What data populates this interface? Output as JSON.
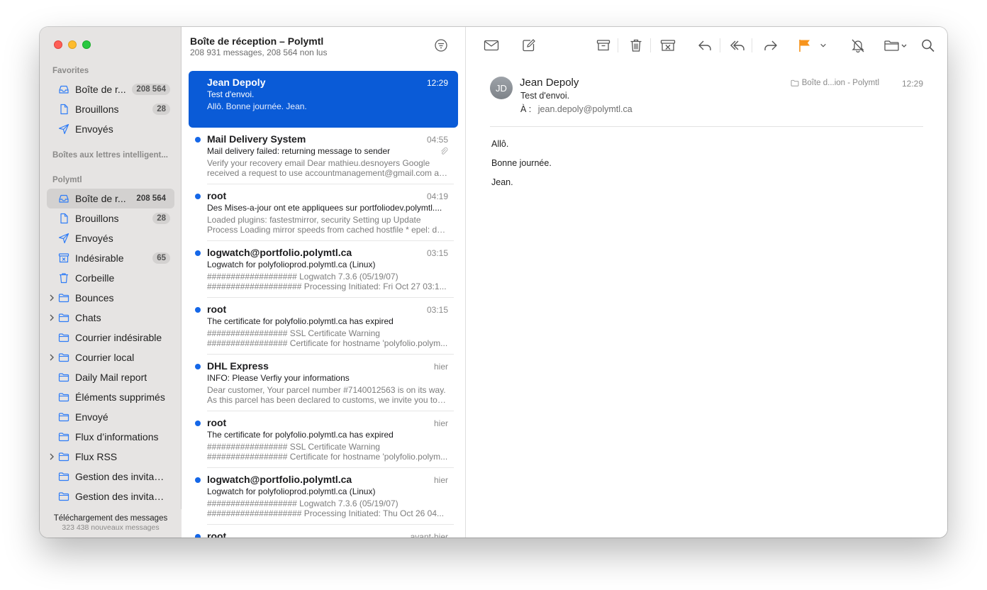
{
  "sidebar": {
    "favorites_title": "Favorites",
    "favorites": [
      {
        "label": "Boîte de r...",
        "badge": "208 564",
        "icon": "inbox-icon"
      },
      {
        "label": "Brouillons",
        "badge": "28",
        "icon": "document-icon"
      },
      {
        "label": "Envoyés",
        "badge": "",
        "icon": "paperplane-icon"
      }
    ],
    "smart_title": "Boîtes aux lettres intelligent...",
    "account_title": "Polymtl",
    "account": [
      {
        "label": "Boîte de r...",
        "badge": "208 564",
        "icon": "inbox-icon",
        "active": true
      },
      {
        "label": "Brouillons",
        "badge": "28",
        "icon": "document-icon"
      },
      {
        "label": "Envoyés",
        "badge": "",
        "icon": "paperplane-icon"
      },
      {
        "label": "Indésirable",
        "badge": "65",
        "icon": "junk-icon"
      },
      {
        "label": "Corbeille",
        "badge": "",
        "icon": "trash-icon"
      },
      {
        "label": "Bounces",
        "badge": "",
        "icon": "folder-icon",
        "expandable": true
      },
      {
        "label": "Chats",
        "badge": "",
        "icon": "folder-icon",
        "expandable": true
      },
      {
        "label": "Courrier indésirable",
        "badge": "",
        "icon": "folder-icon"
      },
      {
        "label": "Courrier local",
        "badge": "",
        "icon": "folder-icon",
        "expandable": true
      },
      {
        "label": "Daily Mail report",
        "badge": "",
        "icon": "folder-icon"
      },
      {
        "label": "Éléments supprimés",
        "badge": "",
        "icon": "folder-icon"
      },
      {
        "label": "Envoyé",
        "badge": "",
        "icon": "folder-icon"
      },
      {
        "label": "Flux d’informations",
        "badge": "",
        "icon": "folder-icon"
      },
      {
        "label": "Flux RSS",
        "badge": "",
        "icon": "folder-icon",
        "expandable": true
      },
      {
        "label": "Gestion des invitati...",
        "badge": "",
        "icon": "folder-icon"
      },
      {
        "label": "Gestion des invitati...",
        "badge": "",
        "icon": "folder-icon"
      }
    ],
    "footer_status": "Téléchargement des messages",
    "footer_count": "323 438 nouveaux messages"
  },
  "mailbox": {
    "title": "Boîte de réception – Polymtl",
    "subtitle": "208 931 messages, 208 564 non lus"
  },
  "messages": [
    {
      "from": "Jean Depoly",
      "time": "12:29",
      "subject": "Test d'envoi.",
      "preview": [
        "Allô. Bonne journée. Jean.",
        ""
      ],
      "unread": false,
      "selected": true
    },
    {
      "from": "Mail Delivery System",
      "time": "04:55",
      "subject": "Mail delivery failed: returning message to sender",
      "preview": [
        "Verify your recovery email Dear mathieu.desnoyers Google",
        "received a request to use accountmanagement@gmail.com as..."
      ],
      "unread": true,
      "attachment": true
    },
    {
      "from": "root",
      "time": "04:19",
      "subject": "Des Mises-a-jour ont ete appliquees sur portfoliodev.polymtl....",
      "preview": [
        "Loaded plugins: fastestmirror, security Setting up Update",
        "Process Loading mirror speeds from cached hostfile * epel: d2l..."
      ],
      "unread": true
    },
    {
      "from": "logwatch@portfolio.polymtl.ca",
      "time": "03:15",
      "subject": "Logwatch for polyfolioprod.polymtl.ca (Linux)",
      "preview": [
        "################### Logwatch 7.3.6 (05/19/07)",
        "#################### Processing Initiated: Fri Oct 27 03:1..."
      ],
      "unread": true
    },
    {
      "from": "root",
      "time": "03:15",
      "subject": "The certificate for polyfolio.polymtl.ca has expired",
      "preview": [
        "################# SSL Certificate Warning",
        "################# Certificate for hostname 'polyfolio.polym..."
      ],
      "unread": true
    },
    {
      "from": "DHL Express",
      "time": "hier",
      "subject": "INFO: Please Verfiy your informations",
      "preview": [
        "Dear customer, Your parcel number #7140012563 is on its way.",
        "As this parcel has been declared to customs, we invite you to p..."
      ],
      "unread": true
    },
    {
      "from": "root",
      "time": "hier",
      "subject": "The certificate for polyfolio.polymtl.ca has expired",
      "preview": [
        "################# SSL Certificate Warning",
        "################# Certificate for hostname 'polyfolio.polym..."
      ],
      "unread": true
    },
    {
      "from": "logwatch@portfolio.polymtl.ca",
      "time": "hier",
      "subject": "Logwatch for polyfolioprod.polymtl.ca (Linux)",
      "preview": [
        "################### Logwatch 7.3.6 (05/19/07)",
        "#################### Processing Initiated: Thu Oct 26 04..."
      ],
      "unread": true
    },
    {
      "from": "root",
      "time": "avant-hier",
      "subject": "",
      "preview": [
        "",
        ""
      ],
      "unread": true
    }
  ],
  "reader": {
    "avatar_initials": "JD",
    "sender": "Jean Depoly",
    "subject": "Test d'envoi.",
    "to_label": "À :",
    "to_address": "jean.depoly@polymtl.ca",
    "mailbox": "Boîte d...ion - Polymtl",
    "time": "12:29",
    "body": [
      "Allô.",
      "Bonne journée.",
      "Jean."
    ]
  },
  "toolbar": {
    "items": [
      "envelope-icon",
      "compose-icon",
      "archive-icon",
      "trash-icon",
      "junk-icon",
      "reply-icon",
      "reply-all-icon",
      "forward-icon",
      "flag-icon",
      "mute-icon",
      "move-folder-icon",
      "search-icon"
    ],
    "flag_color": "#f7941d"
  },
  "colors": {
    "accent": "#0a5bd7",
    "unread_dot": "#1567e8",
    "sidebar_icon": "#2f7cf6"
  }
}
